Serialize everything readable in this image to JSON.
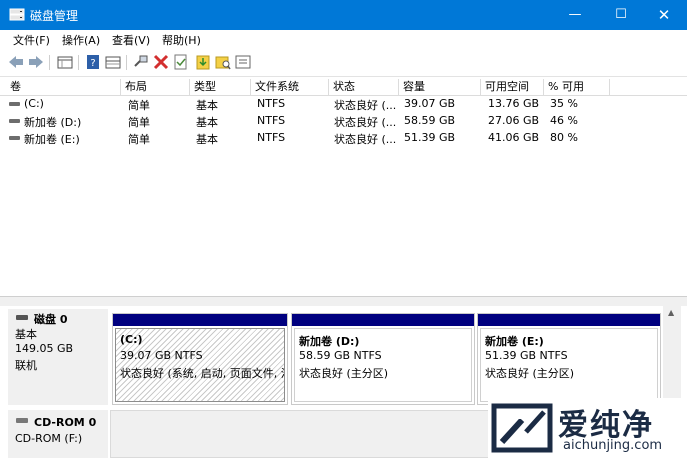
{
  "window": {
    "title": "磁盘管理",
    "controls": {
      "minimize": "—",
      "maximize": "☐",
      "close": "✕"
    }
  },
  "menu": [
    "文件(F)",
    "操作(A)",
    "查看(V)",
    "帮助(H)"
  ],
  "toolbar": {
    "icons": [
      "back-icon",
      "forward-icon",
      "disk-list-icon",
      "help-icon",
      "volume-list-icon",
      "connect-icon",
      "delete-icon",
      "check-icon",
      "import-icon",
      "folder-search-icon",
      "properties-icon"
    ],
    "colors": {
      "delete": "#d32f2f",
      "back": "#6a8cb0"
    }
  },
  "volume_table": {
    "columns": [
      "卷",
      "布局",
      "类型",
      "文件系统",
      "状态",
      "容量",
      "可用空间",
      "% 可用"
    ],
    "rows": [
      [
        "(C:)",
        "简单",
        "基本",
        "NTFS",
        "状态良好 (...",
        "39.07 GB",
        "13.76 GB",
        "35 %"
      ],
      [
        "新加卷 (D:)",
        "简单",
        "基本",
        "NTFS",
        "状态良好 (...",
        "58.59 GB",
        "27.06 GB",
        "46 %"
      ],
      [
        "新加卷 (E:)",
        "简单",
        "基本",
        "NTFS",
        "状态良好 (...",
        "51.39 GB",
        "41.06 GB",
        "80 %"
      ]
    ]
  },
  "disks": {
    "disk0": {
      "name": "磁盘 0",
      "type": "基本",
      "size": "149.05 GB",
      "status": "联机",
      "partitions": [
        {
          "name": "(C:)",
          "size": "39.07 GB NTFS",
          "status": "状态良好 (系统, 启动, 页面文件, 活"
        },
        {
          "name": "新加卷 (D:)",
          "size": "58.59 GB NTFS",
          "status": "状态良好 (主分区)"
        },
        {
          "name": "新加卷 (E:)",
          "size": "51.39 GB NTFS",
          "status": "状态良好 (主分区)"
        }
      ]
    },
    "cdrom0": {
      "name": "CD-ROM 0",
      "type": "CD-ROM (F:)"
    }
  },
  "watermark": {
    "brand": "爱纯净",
    "url": "aichunjing.com"
  },
  "colors": {
    "titlebar": "#0078d7",
    "partition_band": "#00007f",
    "watermark": "#1b2b44"
  }
}
